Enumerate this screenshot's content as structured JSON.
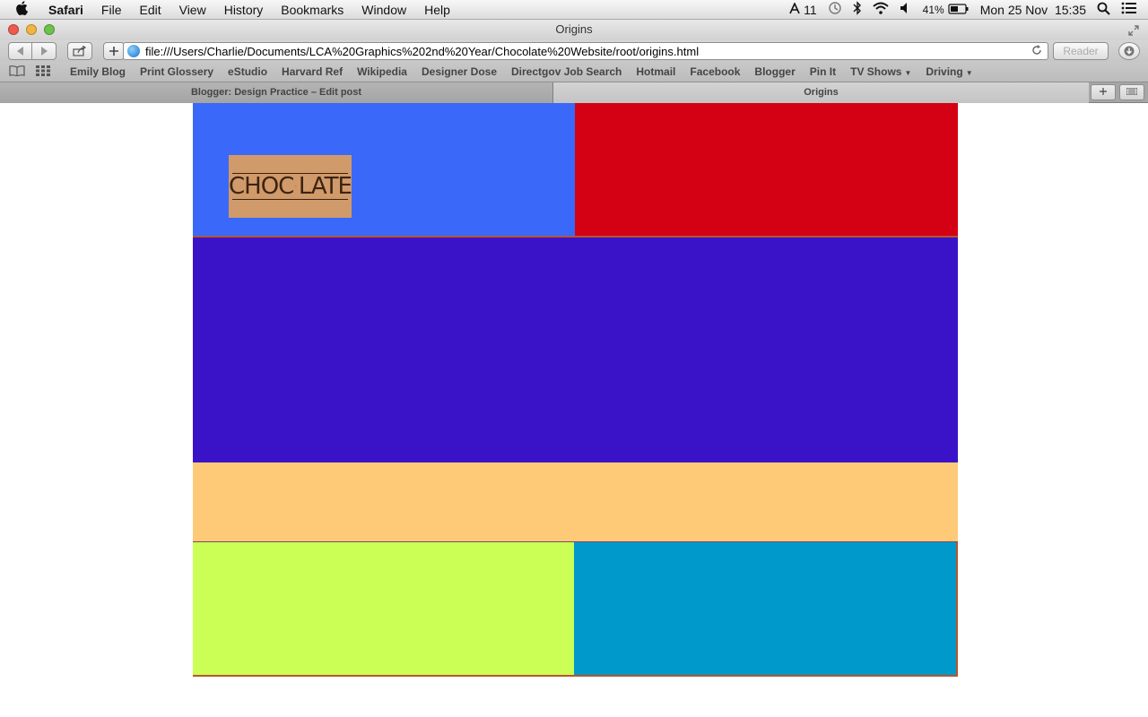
{
  "menubar": {
    "apple_icon": "apple-logo",
    "app_name": "Safari",
    "menus": [
      "File",
      "Edit",
      "View",
      "History",
      "Bookmarks",
      "Window",
      "Help"
    ],
    "status": {
      "adobe_count": "11",
      "battery": "41%",
      "clock": "Mon 25 Nov  15:35"
    }
  },
  "window": {
    "title": "Origins",
    "toolbar": {
      "url": "file:///Users/Charlie/Documents/LCA%20Graphics%202nd%20Year/Chocolate%20Website/root/origins.html",
      "reader_label": "Reader"
    },
    "bookmarks": [
      "Emily Blog",
      "Print Glossery",
      "eStudio",
      "Harvard Ref",
      "Wikipedia",
      "Designer Dose",
      "Directgov Job Search",
      "Hotmail",
      "Facebook",
      "Blogger",
      "Pin It"
    ],
    "bookmark_folders": [
      "TV Shows",
      "Driving"
    ],
    "tabs": [
      {
        "label": "Blogger: Design Practice – Edit post",
        "active": false
      },
      {
        "label": "Origins",
        "active": true
      }
    ]
  },
  "page": {
    "logo_text_left": "CHOC",
    "logo_text_right": "LATE",
    "colors": {
      "header_left": "#3a68f8",
      "header_right": "#d40014",
      "main_band": "#3a13c9",
      "peach_band": "#ffca78",
      "footer_left": "#ccff55",
      "footer_right": "#0099cc",
      "logo_bg": "#d19a6a"
    }
  }
}
